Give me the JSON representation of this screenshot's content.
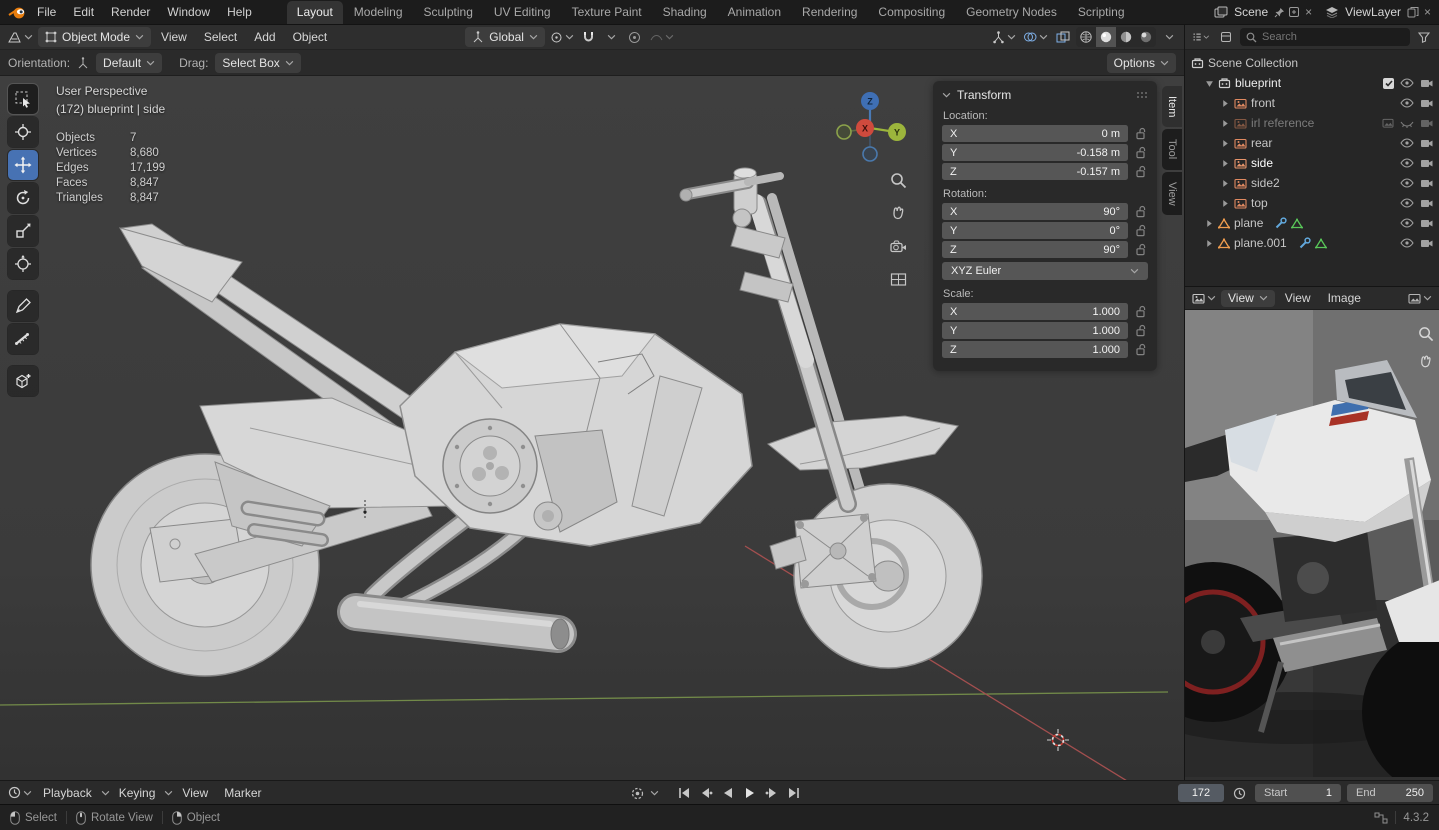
{
  "icons": {
    "chevron_down": "⌄",
    "triangle_right": "▶",
    "triangle_down": "▼",
    "check": "✓",
    "close": "×"
  },
  "topbar": {
    "menus": [
      "File",
      "Edit",
      "Render",
      "Window",
      "Help"
    ],
    "tabs": [
      "Layout",
      "Modeling",
      "Sculpting",
      "UV Editing",
      "Texture Paint",
      "Shading",
      "Animation",
      "Rendering",
      "Compositing",
      "Geometry Nodes",
      "Scripting"
    ],
    "active_tab": "Layout",
    "scene_label": "Scene",
    "viewlayer_label": "ViewLayer"
  },
  "header": {
    "mode": "Object Mode",
    "menus": [
      "View",
      "Select",
      "Add",
      "Object"
    ],
    "orientation": "Global"
  },
  "tool_settings": {
    "orientation_label": "Orientation:",
    "orientation_value": "Default",
    "drag_label": "Drag:",
    "drag_value": "Select Box",
    "options": "Options"
  },
  "viewport": {
    "title": "User Perspective",
    "subtitle": "(172) blueprint | side",
    "stats": [
      {
        "label": "Objects",
        "value": "7"
      },
      {
        "label": "Vertices",
        "value": "8,680"
      },
      {
        "label": "Edges",
        "value": "17,199"
      },
      {
        "label": "Faces",
        "value": "8,847"
      },
      {
        "label": "Triangles",
        "value": "8,847"
      }
    ],
    "gizmo": {
      "x": "X",
      "y": "Y",
      "z": "Z"
    }
  },
  "npanel": {
    "tabs": [
      "Item",
      "Tool",
      "View"
    ],
    "title": "Transform",
    "location_label": "Location:",
    "rotation_label": "Rotation:",
    "scale_label": "Scale:",
    "euler": "XYZ Euler",
    "location": [
      {
        "axis": "X",
        "value": "0 m"
      },
      {
        "axis": "Y",
        "value": "-0.158 m"
      },
      {
        "axis": "Z",
        "value": "-0.157 m"
      }
    ],
    "rotation": [
      {
        "axis": "X",
        "value": "90°"
      },
      {
        "axis": "Y",
        "value": "0°"
      },
      {
        "axis": "Z",
        "value": "90°"
      }
    ],
    "scale": [
      {
        "axis": "X",
        "value": "1.000"
      },
      {
        "axis": "Y",
        "value": "1.000"
      },
      {
        "axis": "Z",
        "value": "1.000"
      }
    ]
  },
  "outliner": {
    "search_placeholder": "Search",
    "scene_collection": "Scene Collection",
    "rows": [
      {
        "label": "blueprint"
      },
      {
        "label": "front"
      },
      {
        "label": "irl reference"
      },
      {
        "label": "rear"
      },
      {
        "label": "side"
      },
      {
        "label": "side2"
      },
      {
        "label": "top"
      },
      {
        "label": "plane"
      },
      {
        "label": "plane.001"
      }
    ]
  },
  "image_editor": {
    "mode": "View",
    "menus": [
      "View",
      "Image"
    ]
  },
  "timeline": {
    "menus": [
      "Playback",
      "Keying",
      "View",
      "Marker"
    ],
    "frame": "172",
    "start_label": "Start",
    "start_value": "1",
    "end_label": "End",
    "end_value": "250"
  },
  "statusbar": {
    "hints": [
      "Select",
      "Rotate View",
      "Object"
    ],
    "version": "4.3.2"
  }
}
